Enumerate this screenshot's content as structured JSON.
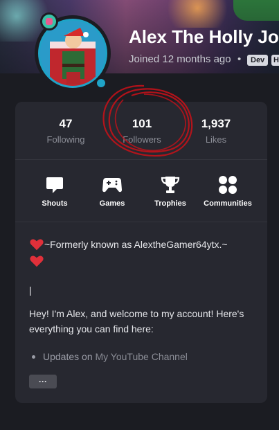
{
  "profile": {
    "name": "Alex The Holly Jo",
    "joined": "Joined 12 months ago",
    "separator": "•",
    "tags": [
      "Dev",
      "H"
    ]
  },
  "stats": [
    {
      "value": "47",
      "label": "Following"
    },
    {
      "value": "101",
      "label": "Followers"
    },
    {
      "value": "1,937",
      "label": "Likes"
    }
  ],
  "nav": [
    {
      "label": "Shouts",
      "icon": "chat-bubble-icon"
    },
    {
      "label": "Games",
      "icon": "gamepad-icon"
    },
    {
      "label": "Trophies",
      "icon": "trophy-icon"
    },
    {
      "label": "Communities",
      "icon": "grid-dots-icon"
    }
  ],
  "bio": {
    "line1": "~Formerly known as AlextheGamer64ytx.~",
    "cursor": "|",
    "paragraph": "Hey! I'm Alex, and welcome to my account! Here's everything you can find here:",
    "list_prefix": "Updates on",
    "list_link": "My YouTube Channel"
  },
  "more_button": "···",
  "colors": {
    "background": "#1b1c22",
    "card": "#272830",
    "avatar_ring": "#1fa3c7",
    "annotation_red": "#c2121a"
  }
}
